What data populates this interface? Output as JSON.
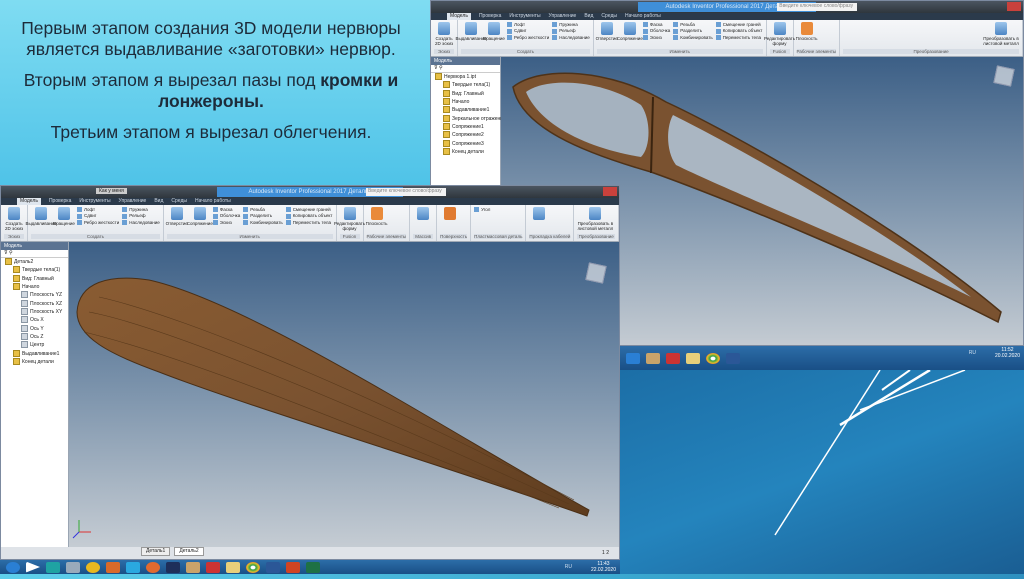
{
  "slide": {
    "p1": "Первым этапом создания 3D модели нервюры является выдавливание «заготовки» нервюр.",
    "p2a": "Вторым этапом я вырезал пазы под ",
    "p2b": "кромки и лонжероны.",
    "p3": "Третьим этапом я вырезал облегчения."
  },
  "app": {
    "quick_view": "Как у меня",
    "title": "Autodesk Inventor Professional 2017  Деталь2",
    "search_placeholder": "Введите ключевое слово/фразу",
    "tabs": [
      "Модель",
      "Проверка",
      "Инструменты",
      "Управление",
      "Вид",
      "Среды",
      "Начало работы"
    ],
    "groups": {
      "sketch": "Эскиз",
      "create": "Создать",
      "modify": "Изменить",
      "fusion": "Fusion",
      "work": "Рабочие элементы",
      "pattern": "Массив",
      "surface": "Поверхность",
      "freeform": "Пластмассовая деталь",
      "harness": "Прокладка кабелей",
      "convert": "Преобразование"
    },
    "buttons": {
      "sketch2d": "Создать 2D эскиз",
      "extrude": "Выдавливание",
      "revolve": "Вращение",
      "loft": "Лофт",
      "sweep": "Сдвиг",
      "rib": "Ребро жесткости",
      "coil": "Пружина",
      "emboss": "Рельеф",
      "derive": "Наследование",
      "hole": "Отверстие",
      "fillet": "Сопряжение",
      "chamfer": "Фаска",
      "shell": "Оболочка",
      "draft": "Эскиз",
      "thread": "Резьба",
      "split": "Разделить",
      "combine": "Комбинировать",
      "offset": "Смещение граней",
      "copy": "Копировать объект",
      "move": "Переместить тела",
      "editform": "Редактировать форму",
      "plane": "Плоскость",
      "corner": "Угол",
      "convert_sheet": "Преобразовать в листовой металл"
    },
    "browser_label": "Модель",
    "tree2": [
      "Деталь2",
      "Твердые тела(1)",
      "Вид: Главный",
      "Начало",
      "Плоскость YZ",
      "Плоскость XZ",
      "Плоскость XY",
      "Ось X",
      "Ось Y",
      "Ось Z",
      "Центр",
      "Выдавливание1",
      "Конец детали"
    ],
    "tree1": [
      "Нервюра 1.ipt",
      "Твердые тела(1)",
      "Вид: Главный",
      "Начало",
      "Выдавливание1",
      "Зеркальное отражение1",
      "Сопряжение1",
      "Сопряжение2",
      "Сопряжение3",
      "Конец детали"
    ],
    "doc_tabs": [
      "Деталь1",
      "Деталь2"
    ],
    "page_nums": "1   2"
  },
  "taskbar1": {
    "lang": "RU",
    "time": "11:43",
    "date": "22.02.2020"
  },
  "taskbar2": {
    "lang": "RU",
    "time": "11:52",
    "date": "20.02.2020"
  },
  "colors": {
    "wood": "#7a5230",
    "wood_light": "#9a6a3e",
    "view_top": "#3c5f86",
    "slide_cyan": "#5fd0ec"
  }
}
